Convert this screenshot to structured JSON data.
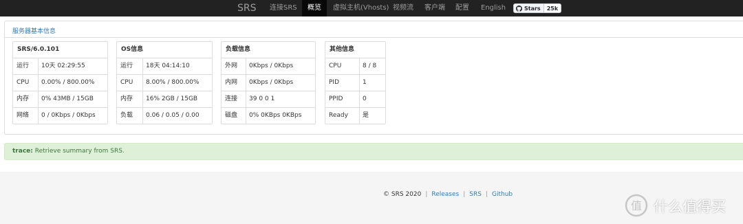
{
  "navbar": {
    "brand": "SRS",
    "items": [
      "连接SRS",
      "概览",
      "虚拟主机(Vhosts)",
      "视频流",
      "客户端",
      "配置",
      "English"
    ],
    "active": "概览",
    "github_badge": {
      "label": "Stars",
      "count": "25k"
    }
  },
  "panel": {
    "title": "服务器基本信息",
    "cards": [
      {
        "title": "SRS/6.0.101",
        "rows": [
          {
            "k": "运行",
            "v": "10天 02:29:55"
          },
          {
            "k": "CPU",
            "v": "0.00% / 800.00%"
          },
          {
            "k": "内存",
            "v": "0% 43MB / 15GB"
          },
          {
            "k": "网络",
            "v": "0 / 0Kbps / 0Kbps"
          }
        ]
      },
      {
        "title": "OS信息",
        "rows": [
          {
            "k": "运行",
            "v": "18天 04:14:10"
          },
          {
            "k": "CPU",
            "v": "8.00% / 800.00%"
          },
          {
            "k": "内存",
            "v": "16% 2GB / 15GB"
          },
          {
            "k": "负载",
            "v": "0.06 / 0.05 / 0.00"
          }
        ]
      },
      {
        "title": "负载信息",
        "rows": [
          {
            "k": "外网",
            "v": "0Kbps / 0Kbps"
          },
          {
            "k": "内网",
            "v": "0Kbps / 0Kbps"
          },
          {
            "k": "连接",
            "v": "39 0 0 1"
          },
          {
            "k": "磁盘",
            "v": "0% 0KBps 0KBps"
          }
        ]
      },
      {
        "title": "其他信息",
        "rows": [
          {
            "k": "CPU",
            "v": "8 / 8"
          },
          {
            "k": "PID",
            "v": "1"
          },
          {
            "k": "PPID",
            "v": "0"
          },
          {
            "k": "Ready",
            "v": "是"
          }
        ]
      }
    ]
  },
  "alert": {
    "level": "trace:",
    "message": "Retrieve summary from SRS."
  },
  "footer": {
    "copyright": "© SRS 2020",
    "links": [
      "Releases",
      "SRS",
      "Github"
    ]
  },
  "watermark": {
    "text": "什么值得买"
  },
  "colors": {
    "navbar_bg": "#222222",
    "link": "#337ab7",
    "alert_bg": "#dff0d8",
    "alert_text": "#3c763d",
    "footer_bg": "#f5f5f5"
  }
}
